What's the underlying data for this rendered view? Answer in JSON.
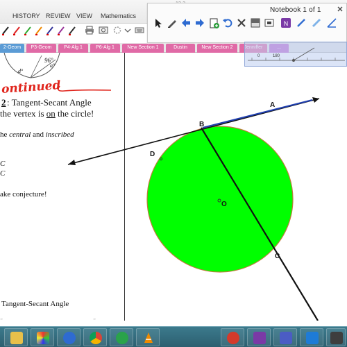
{
  "window": {
    "title": "12-3"
  },
  "menu": {
    "items": [
      "HISTORY",
      "REVIEW",
      "VIEW",
      "Mathematics"
    ]
  },
  "notebook_toolbar": {
    "title": "Notebook  1 of 1",
    "buttons": [
      "select",
      "pen",
      "back",
      "forward",
      "insert-page",
      "undo",
      "delete",
      "screen-shade",
      "capture",
      "onenote",
      "pen-tool",
      "highlighter",
      "angle",
      "line"
    ]
  },
  "tabs": {
    "items": [
      {
        "label": "2-Geom",
        "active": true
      },
      {
        "label": "P3-Geom"
      },
      {
        "label": "P4-Alg 1"
      },
      {
        "label": "P6-Alg 1"
      },
      {
        "label": "New Section 1"
      },
      {
        "label": "Dustin"
      },
      {
        "label": "New Section 2"
      },
      {
        "label": "Jenniffer"
      },
      {
        "label": "..."
      }
    ]
  },
  "protractor": {
    "zero": "0",
    "one_eighty": "180"
  },
  "notes": {
    "angle_label": "96°",
    "small_label_d": "d°",
    "small_label_a": "a°",
    "continued": "ontinued",
    "heading_num": "2",
    "heading_text": ":   Tangent-Secant Angle",
    "vertex_line_pre": " the vertex is ",
    "vertex_line_on": "on",
    "vertex_line_post": " the circle!",
    "central_pre": "he ",
    "central_word": "central",
    "central_and": " and ",
    "inscribed_word": "inscribed",
    "c1": "C",
    "c2": "C",
    "conjecture": "ake conjecture!",
    "footer": "Tangent-Secant Angle"
  },
  "diagram": {
    "fill_color": "#00ff00",
    "point_labels": {
      "A": "A",
      "B": "B",
      "C": "C",
      "D": "D",
      "O": "O"
    }
  },
  "taskbar": {
    "apps": [
      "file-explorer",
      "paint",
      "smartboard-notebook",
      "chrome",
      "media-player",
      "vlc",
      "onenote",
      "teams",
      "lync"
    ]
  }
}
